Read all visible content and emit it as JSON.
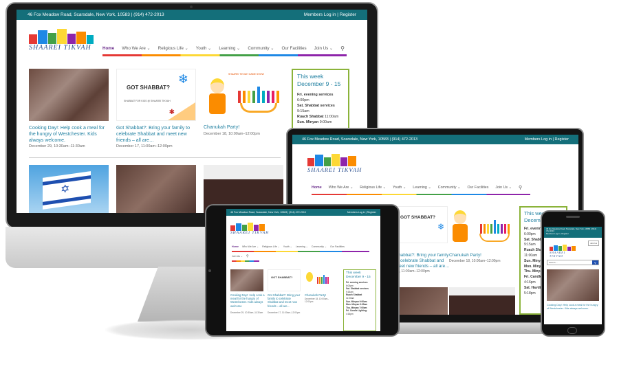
{
  "topbar": {
    "address": "46 Fox Meadow Road, Scarsdale, New York, 10583 | (914) 472-2013",
    "members": "Members Log in | Register"
  },
  "logo": {
    "text": "SHAAREI TIKVAH"
  },
  "nav": {
    "items": [
      "Home",
      "Who We Are ⌄",
      "Religious Life ⌄",
      "Youth ⌄",
      "Learning ⌄",
      "Community ⌄",
      "Our Facilities",
      "Join Us ⌄"
    ]
  },
  "cards": [
    {
      "title": "Cooking Day!: Help cook a meal for the hungry of Westchester. Kids always welcome.",
      "date": "December 29, 10:30am–11:30am"
    },
    {
      "title": "Got Shabbat?: Bring your family to celebrate Shabbat and meet new friends – all are…",
      "date": "December 17, 11:00am–12:00pm"
    },
    {
      "title": "Chanukah Party!",
      "date": "December 18, 10:00am–12:00pm"
    }
  ],
  "promo": {
    "got_shabbat": "GOT SHABBAT?",
    "got_shabbat_sub": "SHABBAT FOR KIDS @ SHAAREI TIKVAH",
    "chanukah_banner": "SHAAREI TIKVAH GAME SHOW"
  },
  "thisweek": {
    "heading": "This week December 9 - 15",
    "heading_short": "This week December 9 - 15",
    "lines": [
      {
        "label": "Fri. evening services",
        "time": "6:00pm"
      },
      {
        "label": "Sat. Shabbat services",
        "time": "9:15am"
      },
      {
        "label": "Ruach Shabbat",
        "time": "11:00am"
      },
      {
        "label": "Sun. Minyan",
        "time": "9:00am"
      }
    ],
    "laptop_lines": [
      "Fri. evening",
      "6:00pm",
      "Sat. Shabba",
      "9:15am",
      "Ruach Sha",
      "11:00am",
      "Sun. Minya",
      "Mon. Minya",
      "Thu. Minya",
      "Fri. Candle",
      "4:16pm",
      "Sat. Havdi",
      "5:18pm"
    ],
    "tablet_lines": [
      "Fri. evening services",
      "6:00pm",
      "Sat. Shabbat services",
      "9:15am",
      "Ruach Shabbat",
      "11:00am",
      "Sun. Minyan 9:00am",
      "Mon. Minyan 9:00am",
      "Thu. Minyan 7:00am",
      "Fri. Candle Lighting:",
      "4:16pm"
    ]
  },
  "phone": {
    "address": "46 Fox Meadow Road, Scarsdale, New York, 10583 | (914) 472-2013",
    "members": "Members Log in | Register",
    "btn": "Join Us",
    "search_placeholder": "Search ...",
    "card": "Cooking Day!: Help cook a meal for the hungry of Westchester. Kids always welcome."
  },
  "laptop": {
    "card2": "Bring your family to celebrate Shabbat and meet new friends – all are…",
    "card2_date": "17, 11:00am–12:00pm",
    "card_title_frag": "Shabbat?:",
    "card2_prefix": "Shabbat?"
  },
  "tablet": {
    "cards": [
      {
        "title": "Cooking Day!: Help cook a meal for the hungry of Westchester. Kids always welcome",
        "date": "December 29, 10:30am–11:30am"
      },
      {
        "title": "Got Shabbat?: Bring your family to celebrate Shabbat and meet new friends – all are…",
        "date": "December 17, 11:00am–12:00pm"
      },
      {
        "title": "Chanukah Party!",
        "date": "December 18, 10:00am–12:00pm"
      }
    ],
    "heading": "This week December 9 - 15"
  }
}
